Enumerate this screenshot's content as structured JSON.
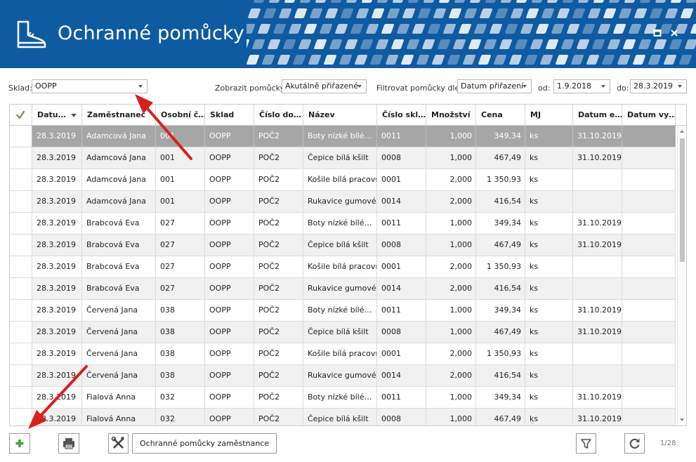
{
  "window": {
    "title": "Ochranné pomůcky",
    "icon": "boot-icon",
    "buttons": [
      "maximize-icon",
      "close-icon"
    ],
    "brand_color": "#0e5ba2"
  },
  "filters": {
    "sklad_label": "Sklad:",
    "sklad_value": "OOPP",
    "zobrazit_label": "Zobrazit pomůcky:",
    "zobrazit_value": "Akutálně přiřazené",
    "filtrovat_label": "Filtrovat pomůcky dle:",
    "filtrovat_value": "Datum přiřazení",
    "od_label": "od:",
    "od_value": "1.9.2018",
    "do_label": "do:",
    "do_value": "28.3.2019"
  },
  "grid": {
    "headers": [
      "Datu…",
      "Zaměstnanec",
      "Osobní č…",
      "Sklad",
      "Číslo do…",
      "Název",
      "Číslo skl…",
      "Množství",
      "Cena",
      "MJ",
      "Datum e…",
      "Datum vy…"
    ],
    "rows": [
      [
        "28.3.2019",
        "Adamcová Jana",
        "001",
        "OOPP",
        "POČ2",
        "Boty nízké bílé…",
        "0011",
        "1,000",
        "349,34",
        "ks",
        "31.10.2019",
        ""
      ],
      [
        "28.3.2019",
        "Adamcová Jana",
        "001",
        "OOPP",
        "POČ2",
        "Čepice bílá kšilt",
        "0008",
        "1,000",
        "467,49",
        "ks",
        "31.10.2019",
        ""
      ],
      [
        "28.3.2019",
        "Adamcová Jana",
        "001",
        "OOPP",
        "POČ2",
        "Košile bílá pracovní",
        "0001",
        "2,000",
        "1 350,93",
        "ks",
        "",
        ""
      ],
      [
        "28.3.2019",
        "Adamcová Jana",
        "001",
        "OOPP",
        "POČ2",
        "Rukavice gumové…",
        "0014",
        "2,000",
        "416,54",
        "ks",
        "",
        ""
      ],
      [
        "28.3.2019",
        "Brabcová Eva",
        "027",
        "OOPP",
        "POČ2",
        "Boty nízké bílé…",
        "0011",
        "1,000",
        "349,34",
        "ks",
        "31.10.2019",
        ""
      ],
      [
        "28.3.2019",
        "Brabcová Eva",
        "027",
        "OOPP",
        "POČ2",
        "Čepice bílá kšilt",
        "0008",
        "1,000",
        "467,49",
        "ks",
        "31.10.2019",
        ""
      ],
      [
        "28.3.2019",
        "Brabcová Eva",
        "027",
        "OOPP",
        "POČ2",
        "Košile bílá pracovní",
        "0001",
        "2,000",
        "1 350,93",
        "ks",
        "",
        ""
      ],
      [
        "28.3.2019",
        "Brabcová Eva",
        "027",
        "OOPP",
        "POČ2",
        "Rukavice gumové…",
        "0014",
        "2,000",
        "416,54",
        "ks",
        "",
        ""
      ],
      [
        "28.3.2019",
        "Červená Jana",
        "038",
        "OOPP",
        "POČ2",
        "Boty nízké bílé…",
        "0011",
        "1,000",
        "349,34",
        "ks",
        "31.10.2019",
        ""
      ],
      [
        "28.3.2019",
        "Červená Jana",
        "038",
        "OOPP",
        "POČ2",
        "Čepice bílá kšilt",
        "0008",
        "1,000",
        "467,49",
        "ks",
        "31.10.2019",
        ""
      ],
      [
        "28.3.2019",
        "Červená Jana",
        "038",
        "OOPP",
        "POČ2",
        "Košile bílá pracovní",
        "0001",
        "2,000",
        "1 350,93",
        "ks",
        "",
        ""
      ],
      [
        "28.3.2019",
        "Červená Jana",
        "038",
        "OOPP",
        "POČ2",
        "Rukavice gumové…",
        "0014",
        "2,000",
        "416,54",
        "ks",
        "",
        ""
      ],
      [
        "28.3.2019",
        "Fialová Anna",
        "032",
        "OOPP",
        "POČ2",
        "Boty nízké bílé…",
        "0011",
        "1,000",
        "349,34",
        "ks",
        "31.10.2019",
        ""
      ],
      [
        "28.3.2019",
        "Fialová Anna",
        "032",
        "OOPP",
        "POČ2",
        "Čepice bílá kšilt",
        "0008",
        "1,000",
        "467,49",
        "ks",
        "31.10.2019",
        ""
      ]
    ],
    "selected_row": 0,
    "check_icon": "checkmark-icon",
    "check_color": "#5aa832"
  },
  "toolbar": {
    "employee_aids_label": "Ochranné pomůcky zaměstnance",
    "add_icon": "plus-icon",
    "print_icon": "printer-icon",
    "tools_icon": "tools-icon",
    "filter_icon": "filter-icon",
    "refresh_icon": "refresh-icon",
    "add_color": "#3aa635"
  },
  "pager": {
    "text": "1/28"
  },
  "annotation_color": "#d9201c"
}
